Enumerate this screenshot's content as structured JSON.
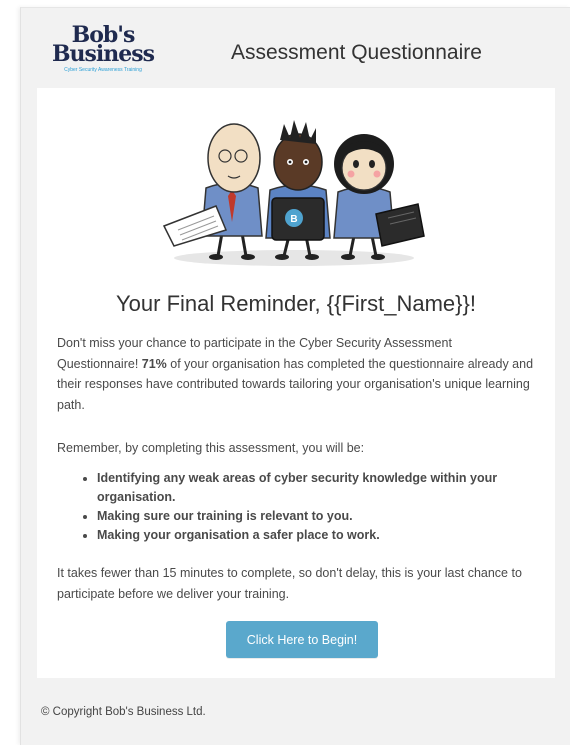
{
  "header": {
    "logo_line1": "Bob's",
    "logo_line2": "Business",
    "logo_tagline": "Cyber Security Awareness Training",
    "title": "Assessment Questionnaire"
  },
  "content": {
    "reminder_title": "Your Final Reminder, {{First_Name}}!",
    "intro_before": "Don't miss your chance to participate in the Cyber Security Assessment Questionnaire! ",
    "intro_percent": "71%",
    "intro_after": " of your organisation has completed the questionnaire already and their responses have contributed towards tailoring your organisation's unique learning path.",
    "remember_text": "Remember, by completing this assessment, you will be:",
    "bullets": [
      "Identifying any weak areas of cyber security knowledge within your organisation.",
      "Making sure our training is relevant to you.",
      "Making your organisation a safer place to work."
    ],
    "closing_text": "It takes fewer than 15 minutes to complete, so don't delay, this is your last chance to participate before we deliver your training.",
    "cta_label": "Click Here to Begin!",
    "hero_badge_letter": "B"
  },
  "footer": {
    "copyright": "© Copyright Bob's Business Ltd."
  },
  "colors": {
    "background": "#f2f2f2",
    "card": "#ffffff",
    "cta": "#5aa8cc",
    "logo_navy": "#1f2a4f",
    "logo_blue": "#2a9fd6"
  }
}
